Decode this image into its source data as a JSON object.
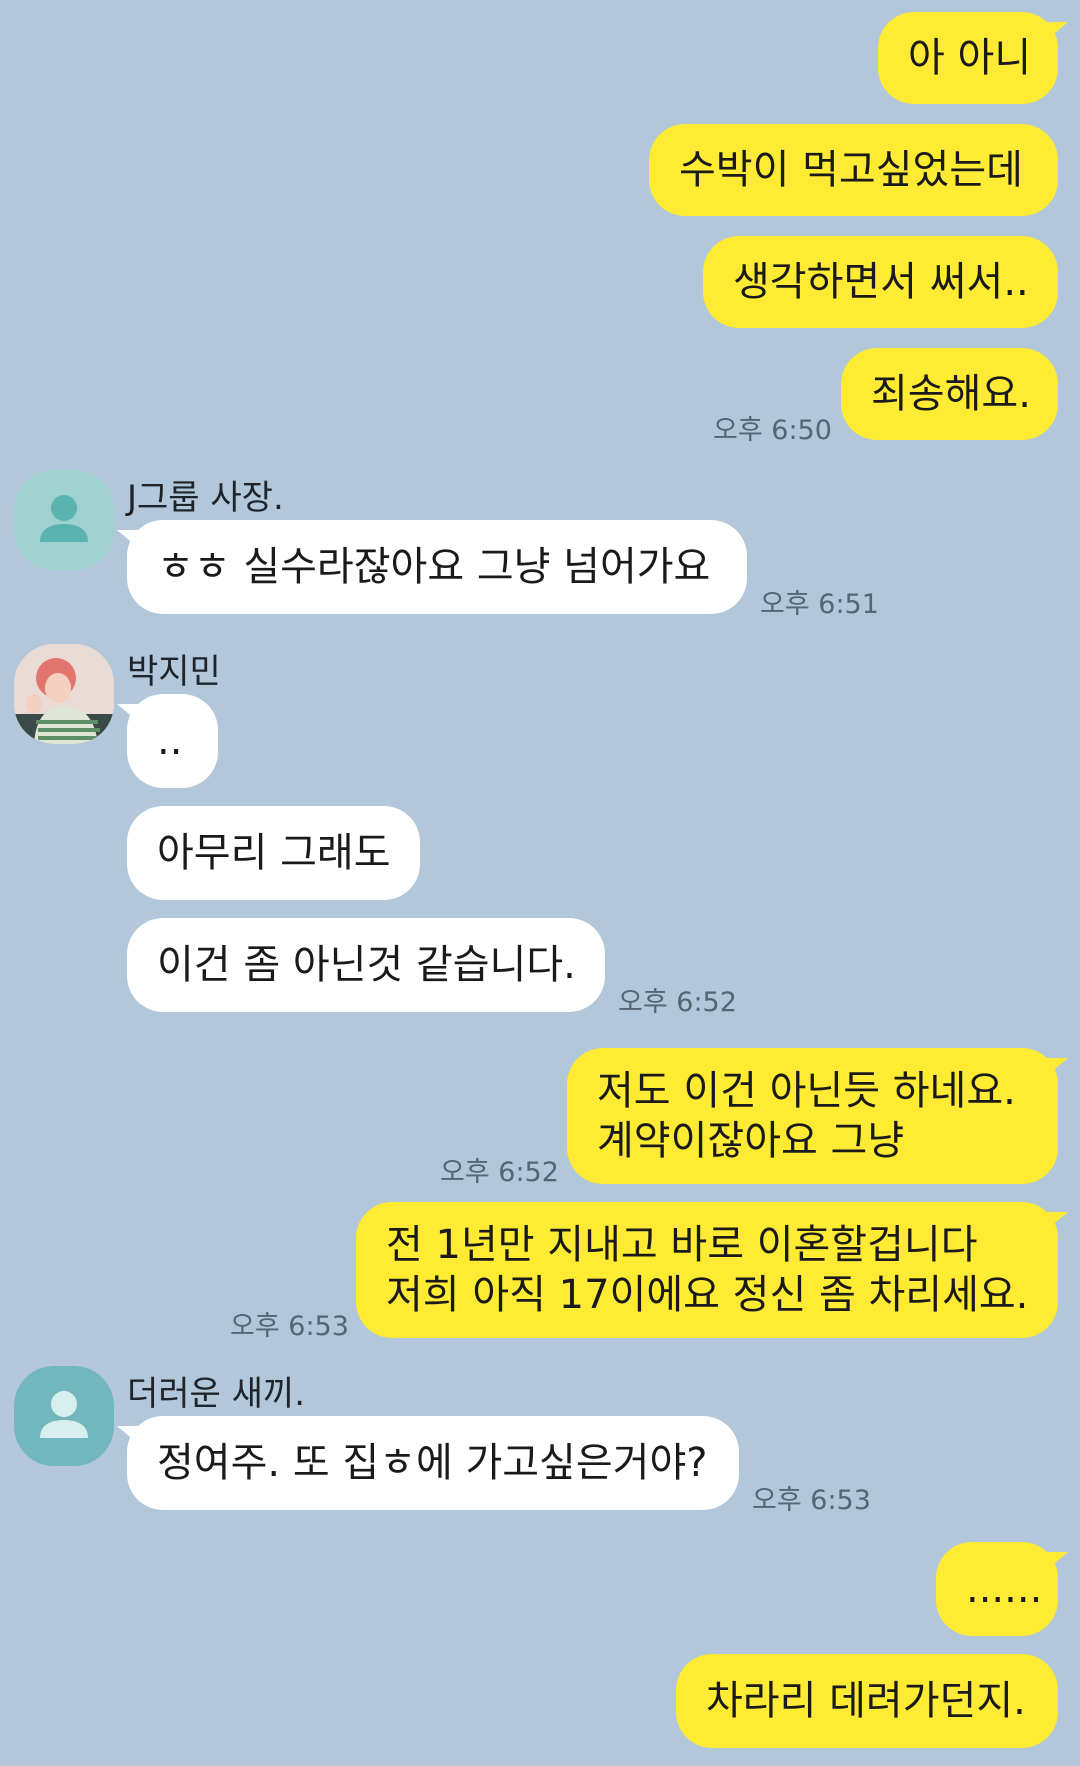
{
  "theme": {
    "background": "#b2c7da",
    "my_bubble": "#ffeb33",
    "their_bubble": "#ffffff"
  },
  "messages": [
    {
      "side": "me",
      "text": "아 아니"
    },
    {
      "side": "me",
      "text": "수박이 먹고싶었는데"
    },
    {
      "side": "me",
      "text": "생각하면서 써서.."
    },
    {
      "side": "me",
      "text": "죄송해요.",
      "time": "오후 6:50"
    },
    {
      "side": "them",
      "sender": "J그룹 사장.",
      "avatar": "default-person-icon",
      "text": "ㅎㅎ 실수라잖아요 그냥 넘어가요",
      "time": "오후 6:51"
    },
    {
      "side": "them",
      "sender": "박지민",
      "avatar": "profile-photo",
      "text": ".."
    },
    {
      "side": "them",
      "text": "아무리 그래도"
    },
    {
      "side": "them",
      "text": "이건 좀 아닌것 같습니다.",
      "time": "오후 6:52"
    },
    {
      "side": "me",
      "text_lines": [
        "저도 이건 아닌듯 하네요.",
        "계약이잖아요 그냥"
      ],
      "time": "오후 6:52"
    },
    {
      "side": "me",
      "text_lines": [
        "전 1년만 지내고 바로 이혼할겁니다",
        "저희 아직 17이에요 정신 좀 차리세요."
      ],
      "time": "오후 6:53"
    },
    {
      "side": "them",
      "sender": "더러운 새끼.",
      "avatar": "default-person-icon",
      "text": "정여주. 또 집ㅎ에 가고싶은거야?",
      "time": "오후 6:53"
    },
    {
      "side": "me",
      "text": "......"
    },
    {
      "side": "me",
      "text": "차라리 데려가던지."
    }
  ]
}
